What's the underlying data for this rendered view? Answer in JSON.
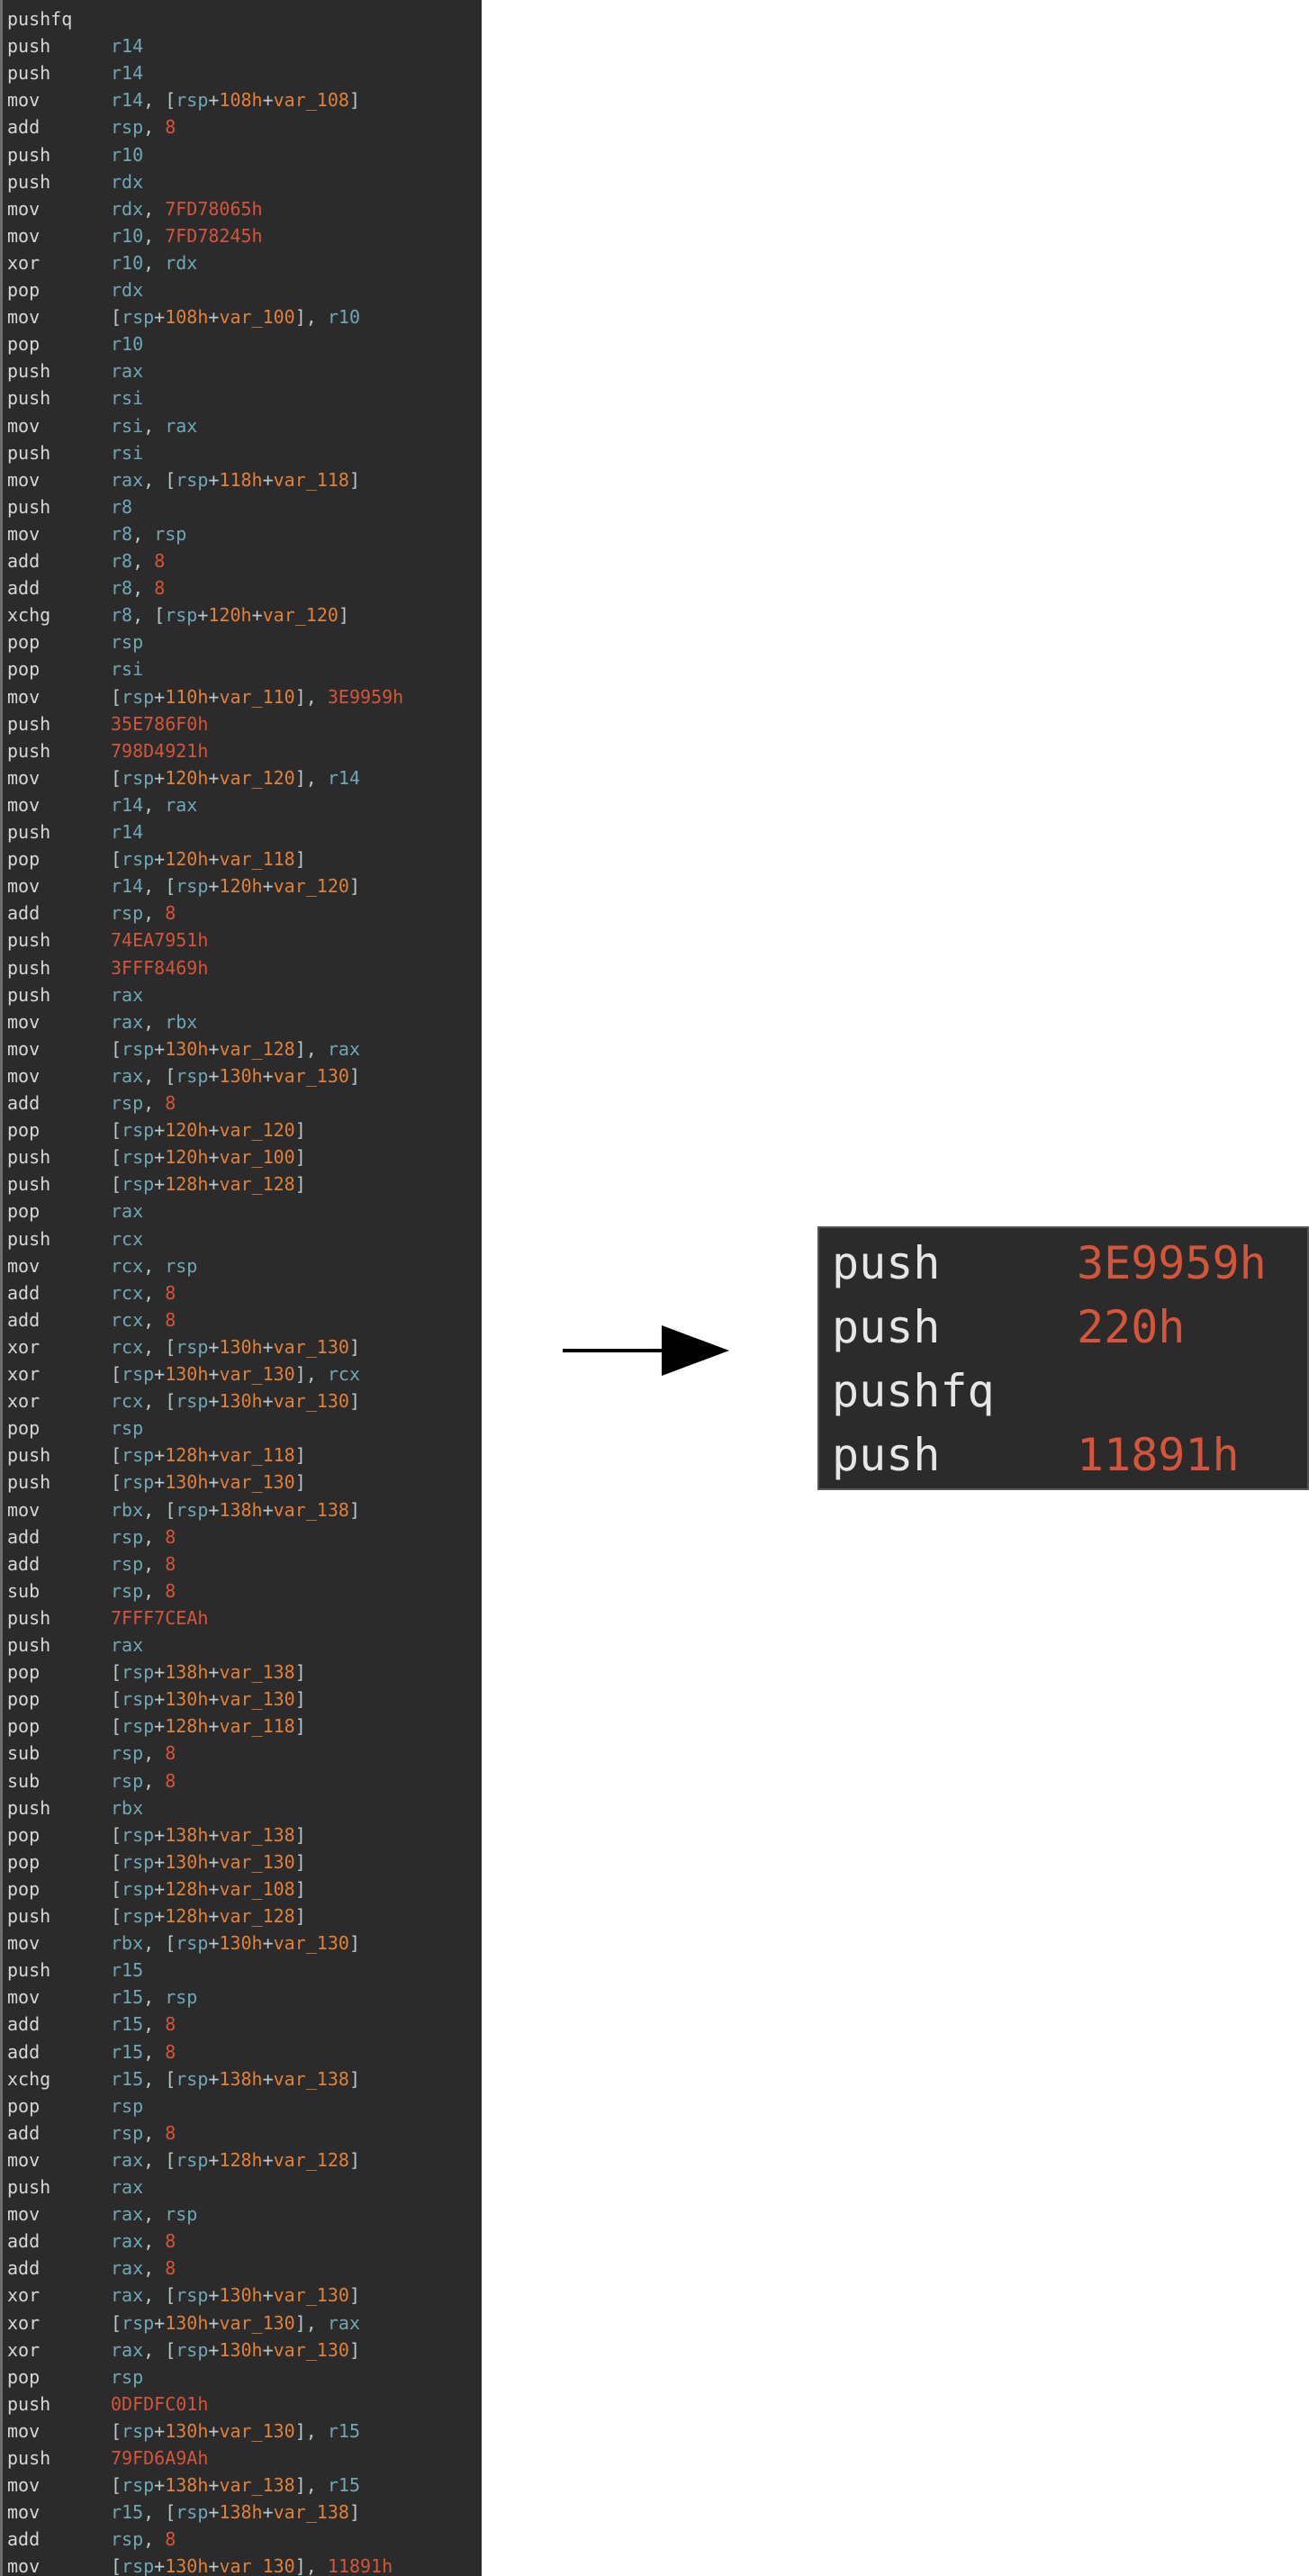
{
  "listing": {
    "lines": [
      {
        "mn": "pushfq",
        "ops": ""
      },
      {
        "mn": "push",
        "ops": "r14"
      },
      {
        "mn": "push",
        "ops": "r14"
      },
      {
        "mn": "mov",
        "ops": "r14, [rsp+108h+var_108]"
      },
      {
        "mn": "add",
        "ops": "rsp, 8"
      },
      {
        "mn": "push",
        "ops": "r10"
      },
      {
        "mn": "push",
        "ops": "rdx"
      },
      {
        "mn": "mov",
        "ops": "rdx, 7FD78065h"
      },
      {
        "mn": "mov",
        "ops": "r10, 7FD78245h"
      },
      {
        "mn": "xor",
        "ops": "r10, rdx"
      },
      {
        "mn": "pop",
        "ops": "rdx"
      },
      {
        "mn": "mov",
        "ops": "[rsp+108h+var_100], r10"
      },
      {
        "mn": "pop",
        "ops": "r10"
      },
      {
        "mn": "push",
        "ops": "rax"
      },
      {
        "mn": "push",
        "ops": "rsi"
      },
      {
        "mn": "mov",
        "ops": "rsi, rax"
      },
      {
        "mn": "push",
        "ops": "rsi"
      },
      {
        "mn": "mov",
        "ops": "rax, [rsp+118h+var_118]"
      },
      {
        "mn": "push",
        "ops": "r8"
      },
      {
        "mn": "mov",
        "ops": "r8, rsp"
      },
      {
        "mn": "add",
        "ops": "r8, 8"
      },
      {
        "mn": "add",
        "ops": "r8, 8"
      },
      {
        "mn": "xchg",
        "ops": "r8, [rsp+120h+var_120]"
      },
      {
        "mn": "pop",
        "ops": "rsp"
      },
      {
        "mn": "pop",
        "ops": "rsi"
      },
      {
        "mn": "mov",
        "ops": "[rsp+110h+var_110], 3E9959h"
      },
      {
        "mn": "push",
        "ops": "35E786F0h"
      },
      {
        "mn": "push",
        "ops": "798D4921h"
      },
      {
        "mn": "mov",
        "ops": "[rsp+120h+var_120], r14"
      },
      {
        "mn": "mov",
        "ops": "r14, rax"
      },
      {
        "mn": "push",
        "ops": "r14"
      },
      {
        "mn": "pop",
        "ops": "[rsp+120h+var_118]"
      },
      {
        "mn": "mov",
        "ops": "r14, [rsp+120h+var_120]"
      },
      {
        "mn": "add",
        "ops": "rsp, 8"
      },
      {
        "mn": "push",
        "ops": "74EA7951h"
      },
      {
        "mn": "push",
        "ops": "3FFF8469h"
      },
      {
        "mn": "push",
        "ops": "rax"
      },
      {
        "mn": "mov",
        "ops": "rax, rbx"
      },
      {
        "mn": "mov",
        "ops": "[rsp+130h+var_128], rax"
      },
      {
        "mn": "mov",
        "ops": "rax, [rsp+130h+var_130]"
      },
      {
        "mn": "add",
        "ops": "rsp, 8"
      },
      {
        "mn": "pop",
        "ops": "[rsp+120h+var_120]"
      },
      {
        "mn": "push",
        "ops": "[rsp+120h+var_100]"
      },
      {
        "mn": "push",
        "ops": "[rsp+128h+var_128]"
      },
      {
        "mn": "pop",
        "ops": "rax"
      },
      {
        "mn": "push",
        "ops": "rcx"
      },
      {
        "mn": "mov",
        "ops": "rcx, rsp"
      },
      {
        "mn": "add",
        "ops": "rcx, 8"
      },
      {
        "mn": "add",
        "ops": "rcx, 8"
      },
      {
        "mn": "xor",
        "ops": "rcx, [rsp+130h+var_130]"
      },
      {
        "mn": "xor",
        "ops": "[rsp+130h+var_130], rcx"
      },
      {
        "mn": "xor",
        "ops": "rcx, [rsp+130h+var_130]"
      },
      {
        "mn": "pop",
        "ops": "rsp"
      },
      {
        "mn": "push",
        "ops": "[rsp+128h+var_118]"
      },
      {
        "mn": "push",
        "ops": "[rsp+130h+var_130]"
      },
      {
        "mn": "mov",
        "ops": "rbx, [rsp+138h+var_138]"
      },
      {
        "mn": "add",
        "ops": "rsp, 8"
      },
      {
        "mn": "add",
        "ops": "rsp, 8"
      },
      {
        "mn": "sub",
        "ops": "rsp, 8"
      },
      {
        "mn": "push",
        "ops": "7FFF7CEAh"
      },
      {
        "mn": "push",
        "ops": "rax"
      },
      {
        "mn": "pop",
        "ops": "[rsp+138h+var_138]"
      },
      {
        "mn": "pop",
        "ops": "[rsp+130h+var_130]"
      },
      {
        "mn": "pop",
        "ops": "[rsp+128h+var_118]"
      },
      {
        "mn": "sub",
        "ops": "rsp, 8"
      },
      {
        "mn": "sub",
        "ops": "rsp, 8"
      },
      {
        "mn": "push",
        "ops": "rbx"
      },
      {
        "mn": "pop",
        "ops": "[rsp+138h+var_138]"
      },
      {
        "mn": "pop",
        "ops": "[rsp+130h+var_130]"
      },
      {
        "mn": "pop",
        "ops": "[rsp+128h+var_108]"
      },
      {
        "mn": "push",
        "ops": "[rsp+128h+var_128]"
      },
      {
        "mn": "mov",
        "ops": "rbx, [rsp+130h+var_130]"
      },
      {
        "mn": "push",
        "ops": "r15"
      },
      {
        "mn": "mov",
        "ops": "r15, rsp"
      },
      {
        "mn": "add",
        "ops": "r15, 8"
      },
      {
        "mn": "add",
        "ops": "r15, 8"
      },
      {
        "mn": "xchg",
        "ops": "r15, [rsp+138h+var_138]"
      },
      {
        "mn": "pop",
        "ops": "rsp"
      },
      {
        "mn": "add",
        "ops": "rsp, 8"
      },
      {
        "mn": "mov",
        "ops": "rax, [rsp+128h+var_128]"
      },
      {
        "mn": "push",
        "ops": "rax"
      },
      {
        "mn": "mov",
        "ops": "rax, rsp"
      },
      {
        "mn": "add",
        "ops": "rax, 8"
      },
      {
        "mn": "add",
        "ops": "rax, 8"
      },
      {
        "mn": "xor",
        "ops": "rax, [rsp+130h+var_130]"
      },
      {
        "mn": "xor",
        "ops": "[rsp+130h+var_130], rax"
      },
      {
        "mn": "xor",
        "ops": "rax, [rsp+130h+var_130]"
      },
      {
        "mn": "pop",
        "ops": "rsp"
      },
      {
        "mn": "push",
        "ops": "0DFDFC01h"
      },
      {
        "mn": "mov",
        "ops": "[rsp+130h+var_130], r15"
      },
      {
        "mn": "push",
        "ops": "79FD6A9Ah"
      },
      {
        "mn": "mov",
        "ops": "[rsp+138h+var_138], r15"
      },
      {
        "mn": "mov",
        "ops": "r15, [rsp+138h+var_138]"
      },
      {
        "mn": "add",
        "ops": "rsp, 8"
      },
      {
        "mn": "mov",
        "ops": "[rsp+130h+var_130], 11891h"
      }
    ]
  },
  "arrow": {
    "icon": "right-arrow-icon"
  },
  "summary": {
    "lines": [
      {
        "mn": "push",
        "op": "3E9959h"
      },
      {
        "mn": "push",
        "op": "220h"
      },
      {
        "mn": "pushfq",
        "op": ""
      },
      {
        "mn": "push",
        "op": "11891h"
      }
    ]
  }
}
